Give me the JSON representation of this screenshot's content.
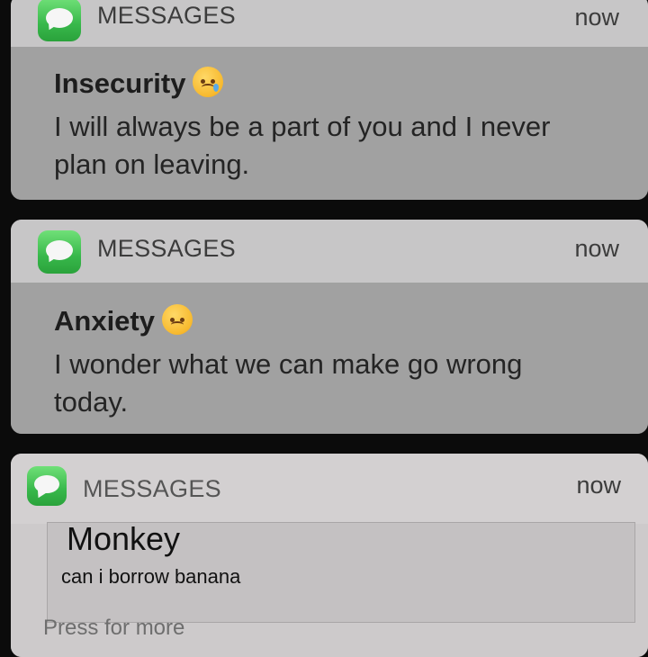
{
  "notifications": [
    {
      "app_name": "MESSAGES",
      "time": "now",
      "sender": "Insecurity",
      "emoji_icon": "crying-face-icon",
      "message_line1": "I will always be a part of you and I never",
      "message_line2": "plan on leaving."
    },
    {
      "app_name": "MESSAGES",
      "time": "now",
      "sender": "Anxiety",
      "emoji_icon": "disappointed-face-icon",
      "message_line1": "I wonder what we can make go wrong",
      "message_line2": "today."
    },
    {
      "app_name": "MESSAGES",
      "time": "now",
      "sender": "Monkey",
      "message": "can i borrow banana",
      "hint": "Press for more"
    }
  ],
  "colors": {
    "background": "#0b0b0b",
    "card_header": "#c7c6c7",
    "card_body": "#a1a1a1",
    "app_icon": "#38b84b",
    "text": "#242424"
  }
}
